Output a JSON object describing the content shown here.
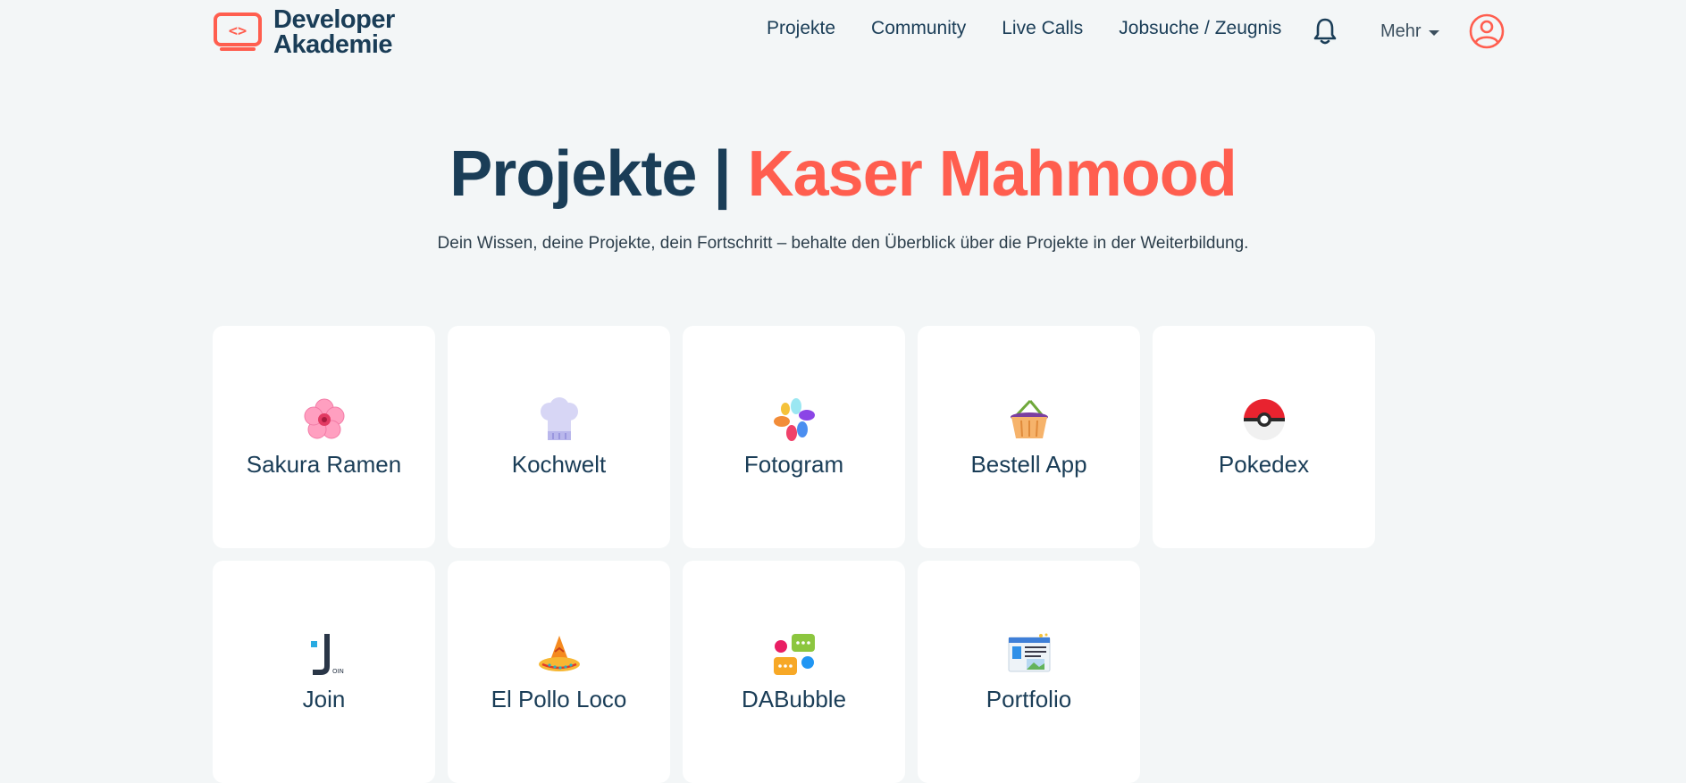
{
  "brand": {
    "line1": "Developer",
    "line2": "Akademie"
  },
  "nav": {
    "items": [
      "Projekte",
      "Community",
      "Live Calls",
      "Jobsuche / Zeugnis"
    ],
    "more_label": "Mehr"
  },
  "hero": {
    "title_prefix": "Projekte",
    "title_separator": "|",
    "title_name": "Kaser Mahmood",
    "subtitle": "Dein Wissen, deine Projekte, dein Fortschritt – behalte den Überblick über die Projekte in der Weiterbildung."
  },
  "projects": [
    {
      "label": "Sakura Ramen",
      "icon": "cherry-blossom-icon"
    },
    {
      "label": "Kochwelt",
      "icon": "chef-hat-icon"
    },
    {
      "label": "Fotogram",
      "icon": "photo-petals-icon"
    },
    {
      "label": "Bestell App",
      "icon": "basket-icon"
    },
    {
      "label": "Pokedex",
      "icon": "pokeball-icon"
    },
    {
      "label": "Join",
      "icon": "join-logo-icon"
    },
    {
      "label": "El Pollo Loco",
      "icon": "sombrero-icon"
    },
    {
      "label": "DABubble",
      "icon": "chat-bubbles-icon"
    },
    {
      "label": "Portfolio",
      "icon": "portfolio-window-icon"
    }
  ],
  "colors": {
    "accent": "#ff5e4f",
    "primary": "#1a3d57",
    "background": "#f3f6f7"
  }
}
